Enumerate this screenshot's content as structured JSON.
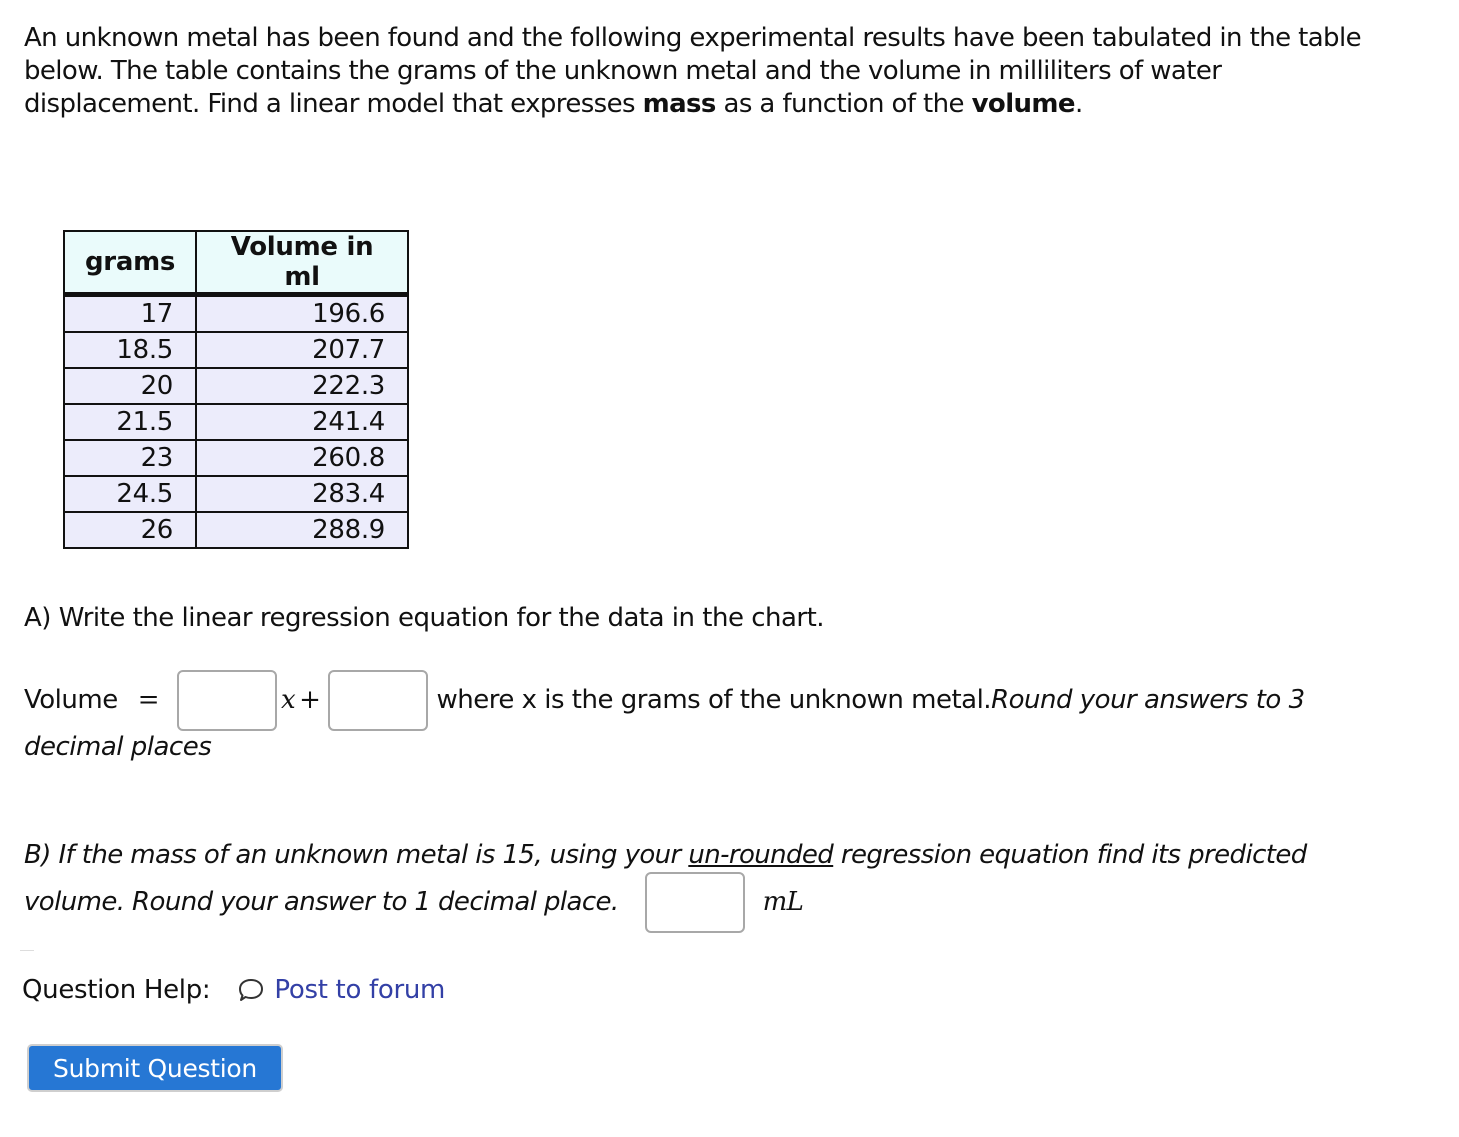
{
  "intro": {
    "text_before_mass": "An unknown metal has been found and the following experimental results have been tabulated in the table below. The table contains the grams of the unknown metal and the volume in milliliters of water displacement. Find a linear model that expresses ",
    "bold_mass": "mass",
    "text_middle": " as a function of the ",
    "bold_volume": "volume",
    "text_end": "."
  },
  "table": {
    "headers": [
      "grams",
      "Volume in ml"
    ],
    "rows": [
      [
        "17",
        "196.6"
      ],
      [
        "18.5",
        "207.7"
      ],
      [
        "20",
        "222.3"
      ],
      [
        "21.5",
        "241.4"
      ],
      [
        "23",
        "260.8"
      ],
      [
        "24.5",
        "283.4"
      ],
      [
        "26",
        "288.9"
      ]
    ]
  },
  "part_a": {
    "prompt": "A) Write the linear regression equation for the data in the chart.",
    "lhs": "Volume",
    "equals": "=",
    "x_var": "x",
    "plus": "+",
    "slope_value": "",
    "intercept_value": "",
    "where_text": "where x is the grams of the unknown metal. ",
    "round_text": "Round your answers to 3",
    "round_text_cont": "decimal places"
  },
  "part_b": {
    "prompt_start": "B)  If the mass of an unknown metal is 15, using your ",
    "underlined": "un-rounded",
    "prompt_end": " regression equation find its predicted",
    "line2": "volume.  Round your answer to 1 decimal place.",
    "answer_value": "",
    "unit": "mL"
  },
  "help": {
    "label": "Question Help:",
    "icon": "speech-bubble-icon",
    "link": "Post to forum"
  },
  "submit": {
    "label": "Submit Question"
  },
  "colors": {
    "link": "#3340a6",
    "button": "#2677d4",
    "header_bg": "#eafbfb",
    "cell_bg": "#ececfb"
  }
}
